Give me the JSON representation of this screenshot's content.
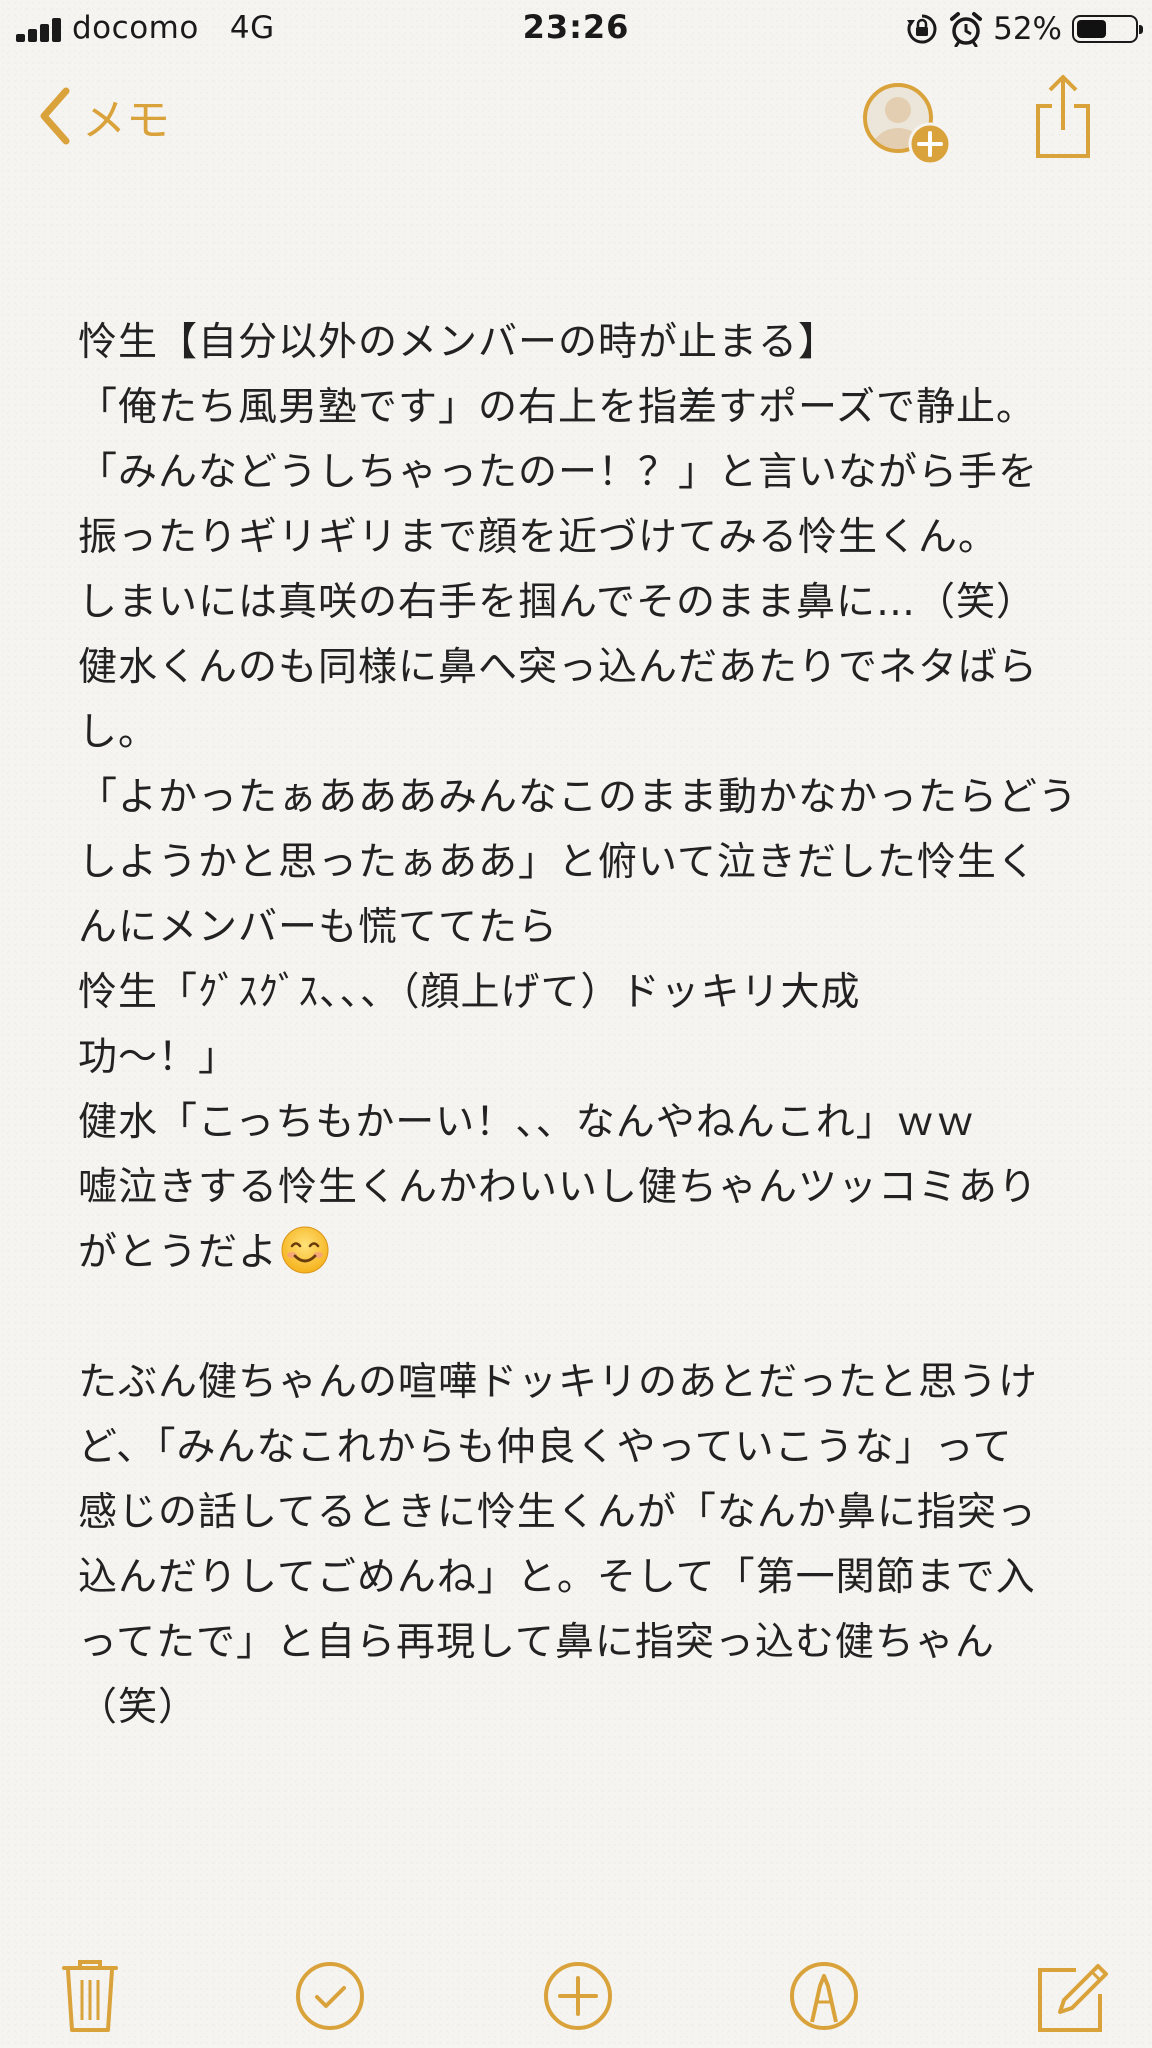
{
  "status_bar": {
    "carrier": "docomo",
    "network": "4G",
    "time": "23:26",
    "battery_percent": "52%",
    "battery_level": 0.52,
    "icons": [
      "signal-icon",
      "rotation-lock-icon",
      "alarm-icon",
      "battery-icon"
    ]
  },
  "nav": {
    "back_label": "メモ",
    "icons": [
      "chevron-left-icon",
      "add-person-icon",
      "share-icon"
    ]
  },
  "note": {
    "lines": [
      "怜生【自分以外のメンバーの時が止まる】",
      "「俺たち風男塾です」の右上を指差すポーズで静止。",
      "「みんなどうしちゃったのー！？」と言いながら手を",
      "振ったりギリギリまで顔を近づけてみる怜生くん。",
      "しまいには真咲の右手を掴んでそのまま鼻に…（笑）",
      "健水くんのも同様に鼻へ突っ込んだあたりでネタばら",
      "し。",
      "「よかったぁあああみんなこのまま動かなかったらどう",
      "しようかと思ったぁああ」と俯いて泣きだした怜生く",
      "んにメンバーも慌ててたら",
      "怜生「ｸﾞｽｸﾞｽ、、、（顔上げて）ドッキリ大成",
      "功〜！」",
      "健水「こっちもかーい！、、なんやねんこれ」ｗｗ",
      "嘘泣きする怜生くんかわいいし健ちゃんツッコミあり",
      "がとうだよ",
      "",
      "たぶん健ちゃんの喧嘩ドッキリのあとだったと思うけ",
      "ど、「みんなこれからも仲良くやっていこうな」って",
      "感じの話してるときに怜生くんが「なんか鼻に指突っ",
      "込んだりしてごめんね」と。そして「第一関節まで入",
      "ってたで」と自ら再現して鼻に指突っ込む健ちゃん",
      "（笑）"
    ],
    "emoji": "smiling-face-emoji"
  },
  "toolbar": {
    "icons": [
      "trash-icon",
      "checklist-icon",
      "add-icon",
      "markup-icon",
      "compose-icon"
    ]
  },
  "colors": {
    "accent": "#d9a23b",
    "text": "#222222",
    "background": "#f5f4f1"
  }
}
